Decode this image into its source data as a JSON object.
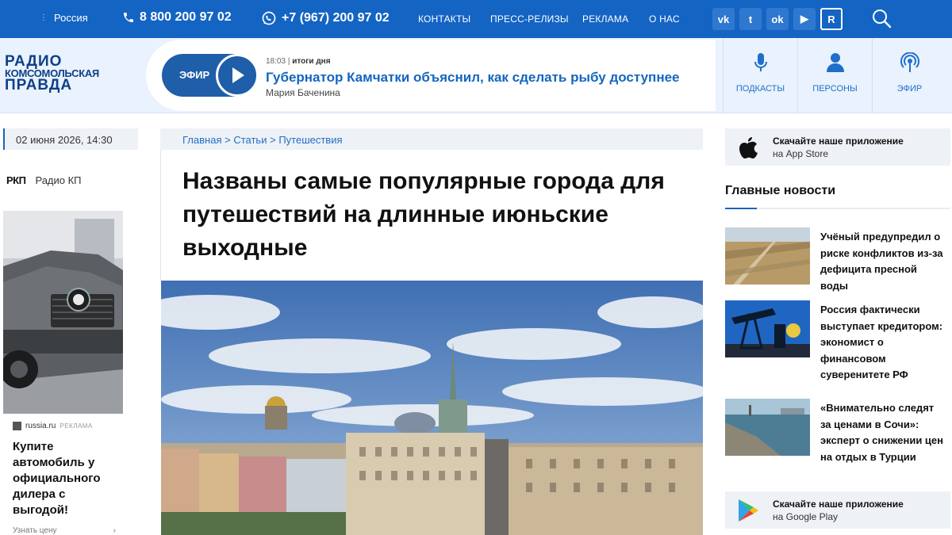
{
  "topbar": {
    "region": "Россия",
    "phone1": "8 800 200 97 02",
    "phone2": "+7 (967) 200 97 02",
    "nav": [
      {
        "label": "КОНТАКТЫ"
      },
      {
        "label": "ПРЕСС-РЕЛИЗЫ"
      },
      {
        "label": "РЕКЛАМА"
      },
      {
        "label": "О НАС"
      }
    ],
    "social": [
      "vk-icon",
      "twitter-icon",
      "odnoklassniki-icon",
      "youtube-icon",
      "rutube-icon"
    ],
    "social_glyphs": {
      "vk": "vk",
      "tw": "t",
      "ok": "ok",
      "yt": "▶",
      "r": "R"
    }
  },
  "header": {
    "logo": {
      "line1": "РАДИО",
      "line2": "КОМСОМОЛЬСКАЯ",
      "line3": "ПРАВДА"
    },
    "live": {
      "button_label": "ЭФИР",
      "time": "18:03",
      "program": "итоги дня",
      "headline": "Губернатор Камчатки объяснил, как сделать рыбу доступнее",
      "author": "Мария Баченина"
    },
    "buttons": [
      {
        "label": "ПОДКАСТЫ"
      },
      {
        "label": "ПЕРСОНЫ"
      },
      {
        "label": "ЭФИР"
      }
    ]
  },
  "left": {
    "date": "02 июня 2026, 14:30",
    "rkp_mark": "РКП",
    "rkp_label": "Радио КП",
    "ad": {
      "source": "russia.ru",
      "tag": "РЕКЛАМА",
      "title": "Купите автомобиль у официального дилера с выгодой!",
      "more": "Узнать цену",
      "more_arrow": "›"
    }
  },
  "main": {
    "breadcrumbs": [
      {
        "label": "Главная"
      },
      {
        "label": "Статьи"
      },
      {
        "label": "Путешествия"
      }
    ],
    "breadcrumb_sep": ">",
    "title": "Названы самые популярные города для путешествий на длинные июньские выходные"
  },
  "right": {
    "app_store": {
      "line1": "Скачайте наше приложение",
      "line2": "на App Store"
    },
    "main_news_heading": "Главные новости",
    "news": [
      {
        "text": "Учёный предупредил о риске конфликтов из-за дефицита пресной воды"
      },
      {
        "text": "Россия фактически выступает кредитором: экономист о финансовом суверенитете РФ"
      },
      {
        "text": "«Внимательно следят за ценами в Сочи»: эксперт о снижении цен на отдых в Турции"
      }
    ],
    "google_play": {
      "line1": "Скачайте наше приложение",
      "line2": "на Google Play"
    }
  },
  "colors": {
    "topbar": "#1464c4",
    "header_bg": "#e9f2fd",
    "accent": "#1565c0",
    "link": "#1f6fca"
  }
}
